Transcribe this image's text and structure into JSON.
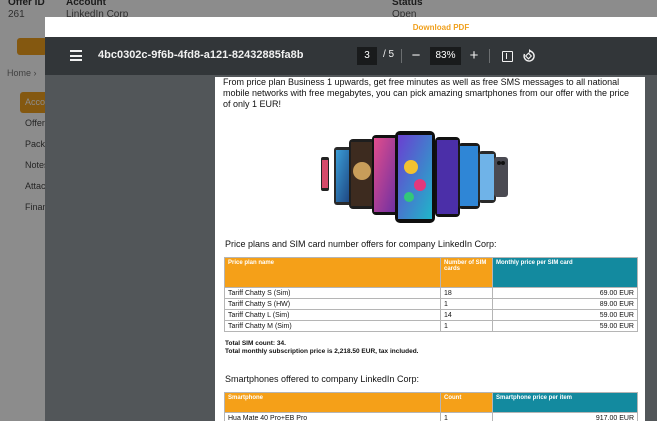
{
  "background": {
    "headers": [
      "Offer ID",
      "Account",
      "Status"
    ],
    "row": {
      "offer_id": "261",
      "account": "LinkedIn Corp",
      "status": "Open"
    },
    "breadcrumb": "Home",
    "sidebar": [
      "Account",
      "Offer",
      "Packa",
      "Notes",
      "Attac",
      "Finan"
    ]
  },
  "modal": {
    "download_label": "Download PDF"
  },
  "viewer": {
    "document_title": "4bc0302c-9f6b-4fd8-a121-82432885fa8b",
    "current_page": "3",
    "total_pages": "/ 5",
    "zoom": "83%"
  },
  "page": {
    "intro": "From price plan Business 1 upwards, get free minutes as well as free SMS messages to all national mobile networks with free megabytes, you can pick amazing smartphones from our offer with the price of only 1 EUR!",
    "plans_title": "Price plans and SIM card number offers for company LinkedIn Corp:",
    "plans_table": {
      "headers": [
        "Price plan name",
        "Number of SIM cards",
        "Monthly price per SIM card"
      ],
      "rows": [
        [
          "Tariff Chatty S (Sim)",
          "18",
          "69.00 EUR"
        ],
        [
          "Tariff Chatty S (HW)",
          "1",
          "89.00 EUR"
        ],
        [
          "Tariff Chatty L (Sim)",
          "14",
          "59.00 EUR"
        ],
        [
          "Tariff Chatty M (Sim)",
          "1",
          "59.00 EUR"
        ]
      ]
    },
    "sim_count": "Total SIM count: 34.",
    "monthly_total": "Total monthly subscription price is 2,218.50 EUR, tax included.",
    "phones_title": "Smartphones offered to company LinkedIn Corp:",
    "phones_table": {
      "headers": [
        "Smartphone",
        "Count",
        "Smartphone price per item"
      ],
      "rows": [
        [
          "Hua Mate 40 Pro+EB Pro",
          "1",
          "917.00 EUR"
        ]
      ]
    }
  },
  "colors": {
    "accent_orange": "#f5a018",
    "teal": "#138a9f",
    "toolbar": "#323639"
  }
}
